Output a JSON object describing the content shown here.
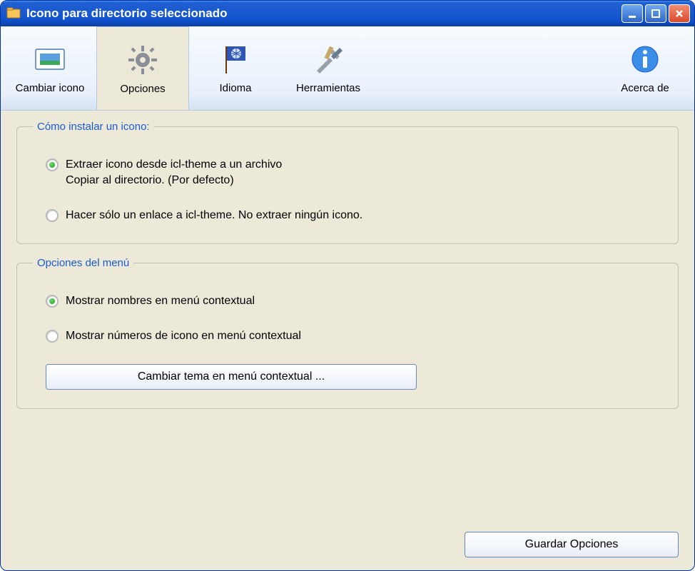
{
  "window": {
    "title": "Icono para directorio seleccionado"
  },
  "toolbar": {
    "items": [
      {
        "label": "Cambiar icono"
      },
      {
        "label": "Opciones"
      },
      {
        "label": "Idioma"
      },
      {
        "label": "Herramientas"
      }
    ],
    "about": "Acerca de"
  },
  "group1": {
    "legend": "Cómo instalar un icono:",
    "opt1_line1": "Extraer icono desde icl-theme a un archivo",
    "opt1_line2": "Copiar al directorio. (Por defecto)",
    "opt2": "Hacer sólo un enlace a icl-theme. No extraer ningún icono.",
    "selected": 0
  },
  "group2": {
    "legend": "Opciones del menú",
    "opt1": "Mostrar nombres en menú contextual",
    "opt2": "Mostrar números de icono en menú contextual",
    "selected": 0,
    "button": "Cambiar tema en menú contextual ..."
  },
  "footer": {
    "save": "Guardar Opciones"
  }
}
